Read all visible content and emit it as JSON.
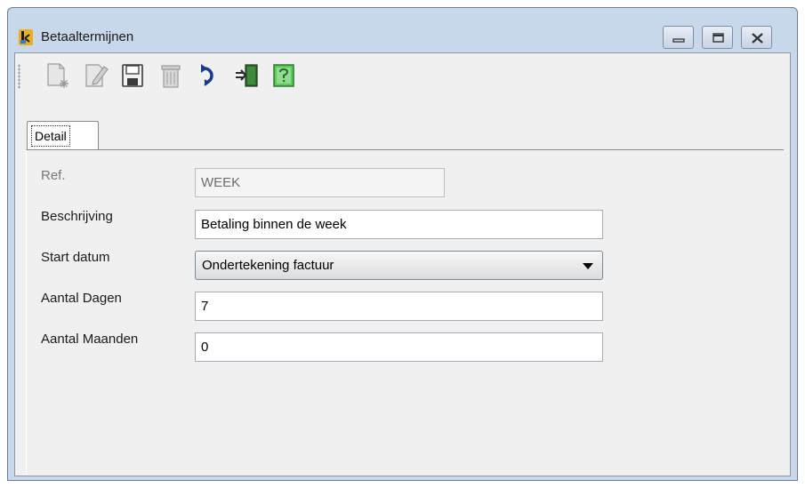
{
  "window": {
    "title": "Betaaltermijnen",
    "icon": "ledger-icon",
    "controls": [
      "minimize-icon",
      "restore-icon",
      "close-icon"
    ]
  },
  "toolbar": {
    "buttons": [
      {
        "name": "new-icon"
      },
      {
        "name": "edit-icon"
      },
      {
        "name": "save-icon"
      },
      {
        "name": "delete-icon"
      },
      {
        "name": "undo-icon"
      },
      {
        "name": "exit-icon"
      },
      {
        "name": "help-icon"
      }
    ]
  },
  "tabs": [
    {
      "label": "Detail"
    }
  ],
  "form": {
    "ref": {
      "label": "Ref.",
      "value": "WEEK"
    },
    "beschrijving": {
      "label": "Beschrijving",
      "value": "Betaling binnen de week"
    },
    "start_datum": {
      "label": "Start datum",
      "value": "Ondertekening factuur"
    },
    "aantal_dagen": {
      "label": "Aantal Dagen",
      "value": "7"
    },
    "aantal_maanden": {
      "label": "Aantal Maanden",
      "value": "0"
    }
  }
}
